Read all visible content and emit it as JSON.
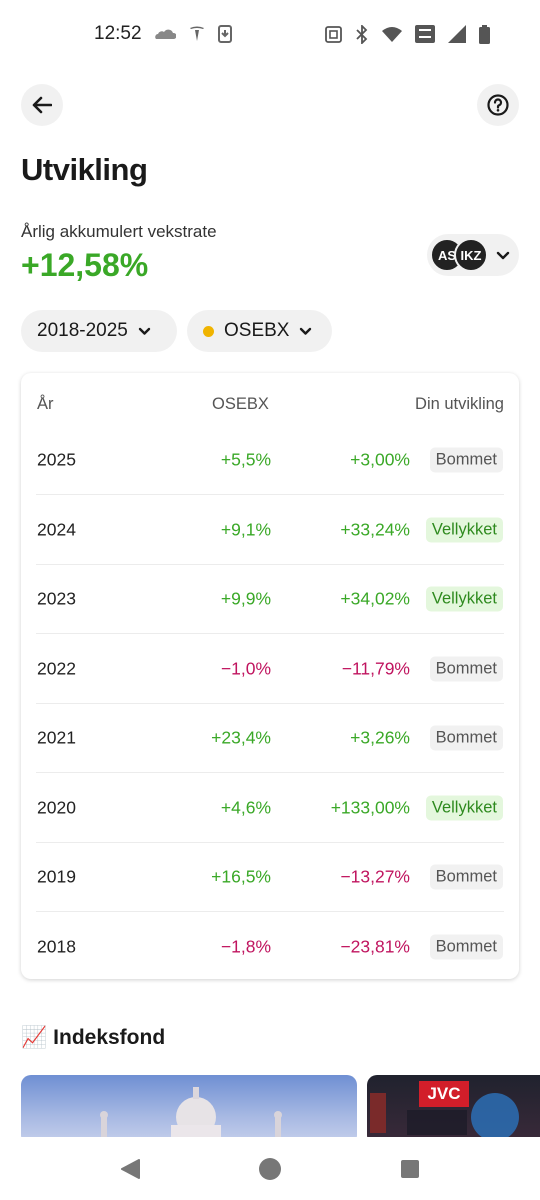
{
  "status_bar": {
    "time": "12:52"
  },
  "header": {
    "title": "Utvikling"
  },
  "summary": {
    "label": "Årlig akkumulert vekstrate",
    "value": "+12,58%"
  },
  "accounts": [
    {
      "initials": "AS"
    },
    {
      "initials": "IKZ"
    }
  ],
  "filters": {
    "period": "2018-2025",
    "index": "OSEBX",
    "index_color": "#f0b400"
  },
  "table": {
    "headers": {
      "year": "År",
      "index": "OSEBX",
      "yours": "Din utvikling"
    },
    "rows": [
      {
        "year": "2025",
        "index": "+5,5%",
        "yours": "+3,00%",
        "status": "Bommet"
      },
      {
        "year": "2024",
        "index": "+9,1%",
        "yours": "+33,24%",
        "status": "Vellykket"
      },
      {
        "year": "2023",
        "index": "+9,9%",
        "yours": "+34,02%",
        "status": "Vellykket"
      },
      {
        "year": "2022",
        "index": "−1,0%",
        "yours": "−11,79%",
        "status": "Bommet"
      },
      {
        "year": "2021",
        "index": "+23,4%",
        "yours": "+3,26%",
        "status": "Bommet"
      },
      {
        "year": "2020",
        "index": "+4,6%",
        "yours": "+133,00%",
        "status": "Vellykket"
      },
      {
        "year": "2019",
        "index": "+16,5%",
        "yours": "−13,27%",
        "status": "Bommet"
      },
      {
        "year": "2018",
        "index": "−1,8%",
        "yours": "−23,81%",
        "status": "Bommet"
      }
    ]
  },
  "section": {
    "emoji": "📈",
    "title": "Indeksfond"
  },
  "fund_cards": {
    "card2_logo": "JVC"
  },
  "colors": {
    "positive": "#3aa827",
    "negative": "#c0145f",
    "hit_bg": "#e4f7dd",
    "miss_bg": "#f1f1f1"
  }
}
